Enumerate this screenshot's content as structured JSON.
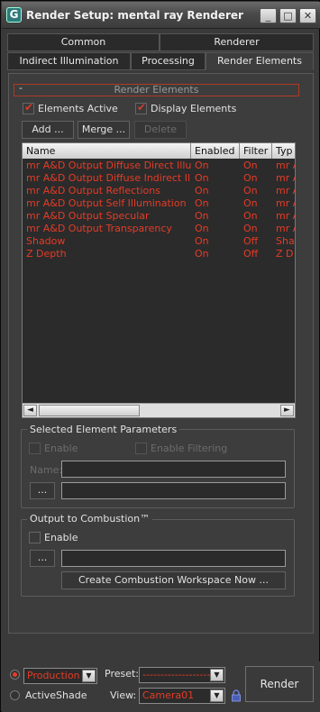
{
  "window": {
    "title": "Render Setup: mental ray Renderer",
    "app_icon_glyph": "G",
    "controls": {
      "minimize": "_",
      "maximize": "□",
      "close": "✕"
    }
  },
  "tabs": {
    "row1": [
      "Common",
      "Renderer"
    ],
    "row2": [
      "Indirect Illumination",
      "Processing",
      "Render Elements"
    ],
    "active": "Render Elements"
  },
  "rollout": {
    "collapse_glyph": "-",
    "title": "Render Elements"
  },
  "options": {
    "elements_active": {
      "label": "Elements Active",
      "checked": true
    },
    "display_elements": {
      "label": "Display Elements",
      "checked": true
    }
  },
  "buttons": {
    "add": "Add ...",
    "merge": "Merge ...",
    "delete": "Delete"
  },
  "table": {
    "columns": [
      "Name",
      "Enabled",
      "Filter",
      "Typ"
    ],
    "rows": [
      [
        "mr A&D Output Diffuse Direct Illumina...",
        "On",
        "On",
        "mr A"
      ],
      [
        "mr A&D Output Diffuse Indirect Illumin...",
        "On",
        "On",
        "mr A"
      ],
      [
        "mr A&D Output Reflections",
        "On",
        "On",
        "mr A"
      ],
      [
        "mr A&D Output Self Illumination",
        "On",
        "On",
        "mr A"
      ],
      [
        "mr A&D Output Specular",
        "On",
        "On",
        "mr A"
      ],
      [
        "mr A&D Output Transparency",
        "On",
        "On",
        "mr A"
      ],
      [
        "Shadow",
        "On",
        "Off",
        "Sha"
      ],
      [
        "Z Depth",
        "On",
        "Off",
        "Z D"
      ]
    ],
    "scroll_left": "◄",
    "scroll_right": "►"
  },
  "selected_params": {
    "title": "Selected Element Parameters",
    "enable_label": "Enable",
    "enable_filtering_label": "Enable Filtering",
    "name_label": "Name:",
    "browse_label": "...",
    "name_value": "",
    "path_value": ""
  },
  "combustion": {
    "title": "Output to Combustion™",
    "enable_label": "Enable",
    "browse_label": "...",
    "path_value": "",
    "create_button": "Create Combustion Workspace Now ..."
  },
  "bottom": {
    "production_label": "Production",
    "activeshade_label": "ActiveShade",
    "production_value": "Production",
    "preset_label": "Preset:",
    "preset_value": "--------------------",
    "view_label": "View:",
    "view_value": "Camera01",
    "render_button": "Render",
    "dropdown_arrow": "▼",
    "mode": "Production"
  },
  "colors": {
    "accent": "#e63b26",
    "panel": "#3d3d3d",
    "list_bg": "#2b2b2b"
  }
}
